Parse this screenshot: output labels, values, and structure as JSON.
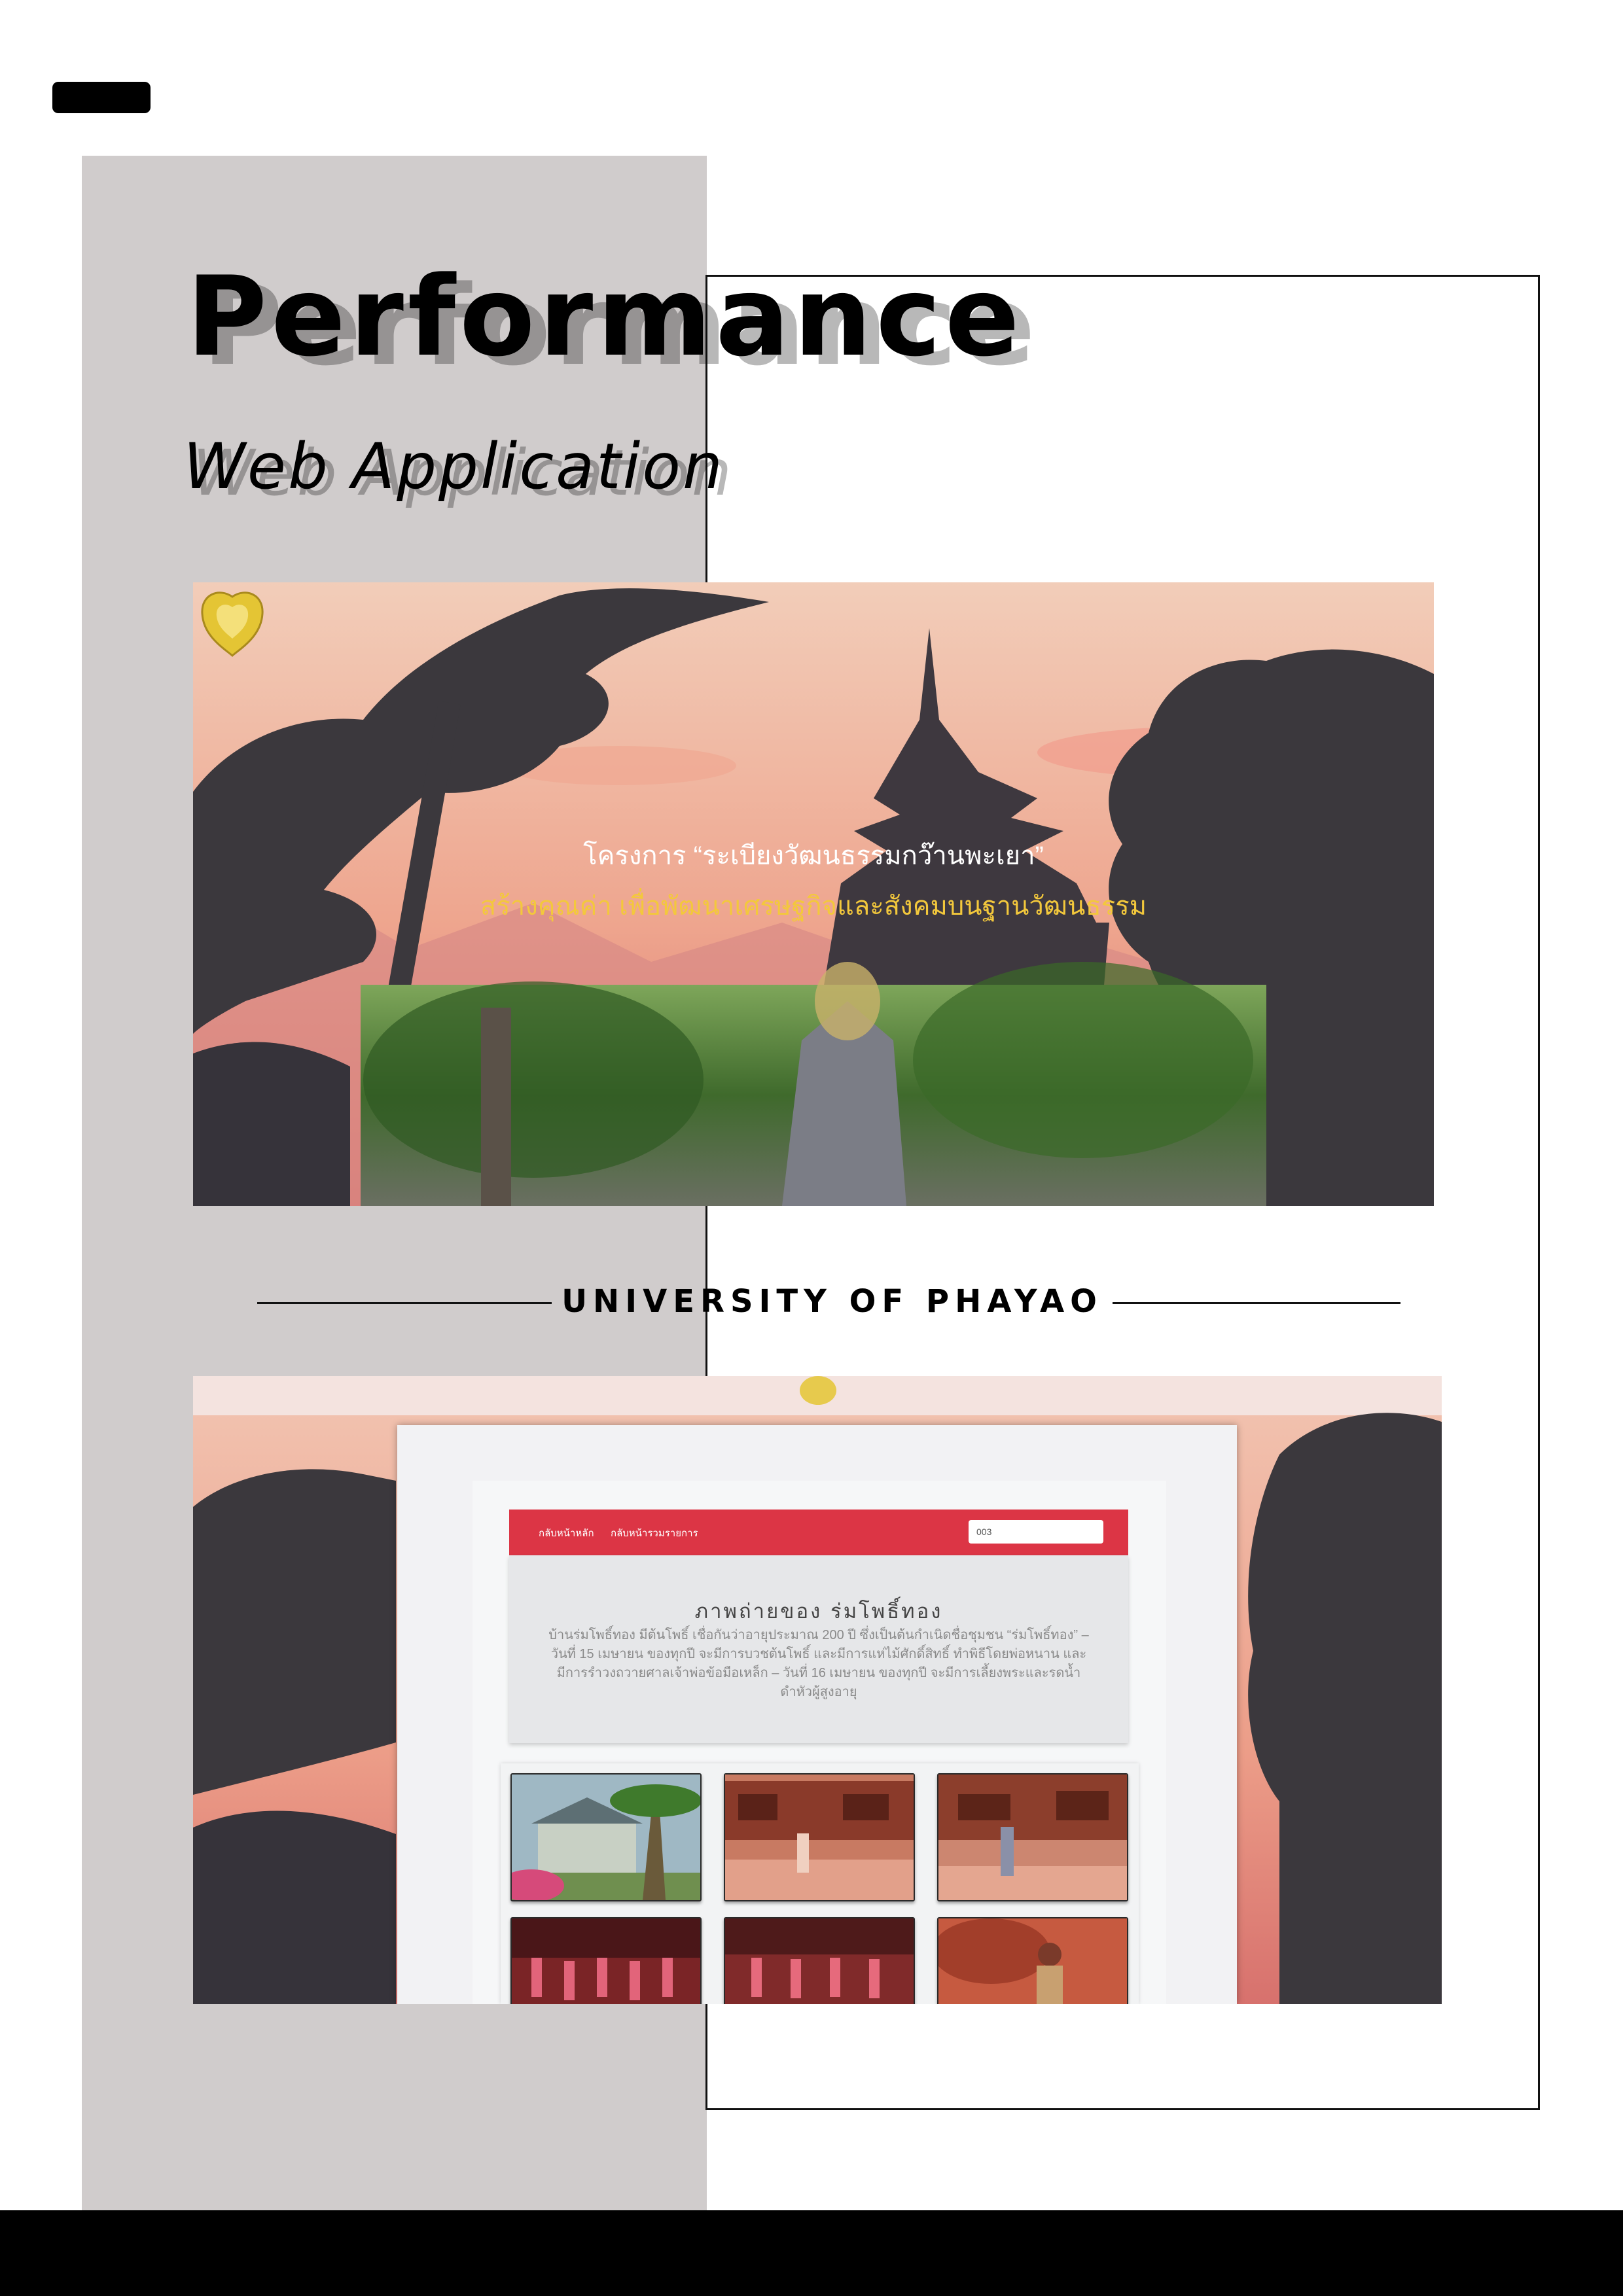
{
  "document": {
    "title": "Performance",
    "subtitle": "Web Application",
    "section_heading": "UNIVERSITY OF PHAYAO"
  },
  "screenshot_1": {
    "project_title": "โครงการ “ระเบียงวัฒนธรรมกว๊านพะเยา”",
    "project_tagline": "สร้างคุณค่า เพื่อพัฒนาเศรษฐกิจและสังคมบนฐานวัฒนธรรม"
  },
  "screenshot_2": {
    "nav": {
      "home_link": "กลับหน้าหลัก",
      "list_link": "กลับหน้ารวมรายการ",
      "search_value": "003"
    },
    "gallery_title": "ภาพถ่ายของ ร่มโพธิ์ทอง",
    "gallery_description": "บ้านร่มโพธิ์ทอง มีต้นโพธิ์ เชื่อกันว่าอายุประมาณ 200 ปี ซึ่งเป็นต้นกำเนิดชื่อชุมชน “ร่มโพธิ์ทอง” – วันที่ 15 เมษายน ของทุกปี จะมีการบวชต้นโพธิ์ และมีการแห่ไม้ศักดิ์สิทธิ์ ทำพิธีโดยพ่อหนาน และมีการรำวงถวายศาลเจ้าพ่อข้อมือเหล็ก – วันที่ 16 เมษายน ของทุกปี จะมีการเลี้ยงพระและรดน้ำดำหัวผู้สูงอายุ",
    "thumbnails": [
      {
        "icon": "house-palms-photo-icon",
        "color": "#6f8f4f"
      },
      {
        "icon": "wooden-house-photo-icon",
        "color": "#b85c42"
      },
      {
        "icon": "wooden-house-photo-icon",
        "color": "#c06a52"
      },
      {
        "icon": "dancers-photo-icon",
        "color": "#9e3a38"
      },
      {
        "icon": "dancers-photo-icon",
        "color": "#a44040"
      },
      {
        "icon": "person-photo-icon",
        "color": "#c65a40"
      }
    ]
  },
  "colors": {
    "navbar": "#dc3545",
    "tagline": "#f3c83c",
    "sky_top": "#f0c8b4",
    "sky_bottom": "#e98a7a",
    "silhouette": "#3b383d"
  }
}
